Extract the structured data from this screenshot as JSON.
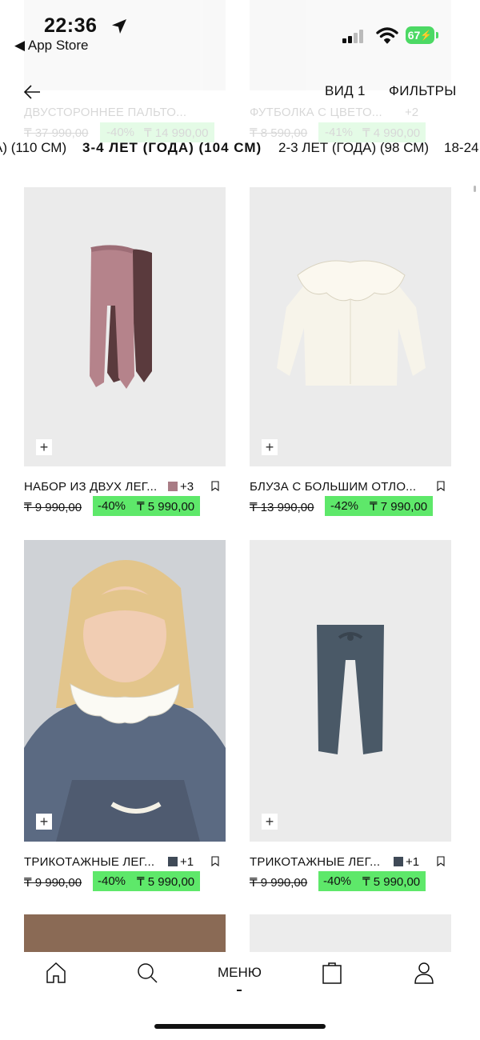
{
  "status_bar": {
    "time": "22:36",
    "back_app": "◀ App Store",
    "battery": "67"
  },
  "header": {
    "view_label": "ВИД 1",
    "filters_label": "ФИЛЬТРЫ"
  },
  "behind": [
    {
      "name": "ДВУСТОРОННЕЕ ПАЛЬТО...",
      "old_price": "₸ 37 990,00",
      "discount": "-40%",
      "price": "₸ 14 990,00"
    },
    {
      "name": "ФУТБОЛКА С ЦВЕТО...",
      "more": "+2",
      "old_price": "₸ 8 590,00",
      "discount": "-41%",
      "price": "₸ 4 990,00"
    }
  ],
  "sizes": [
    {
      "label": "А) (110 СМ)",
      "selected": false
    },
    {
      "label": "3-4 ЛЕТ (ГОДА) (104 СМ)",
      "selected": true
    },
    {
      "label": "2-3 ЛЕТ (ГОДА) (98 СМ)",
      "selected": false
    },
    {
      "label": "18-24",
      "selected": false
    }
  ],
  "products": [
    {
      "name": "НАБОР ИЗ ДВУХ ЛЕГ...",
      "swatch_color": "#a97c85",
      "more": "+3",
      "old_price": "₸ 9 990,00",
      "discount": "-40%",
      "price": "₸ 5 990,00",
      "image": "two leggings"
    },
    {
      "name": "БЛУЗА С БОЛЬШИМ ОТЛО...",
      "old_price": "₸ 13 990,00",
      "discount": "-42%",
      "price": "₸ 7 990,00",
      "image": "white blouse"
    },
    {
      "name": "ТРИКОТАЖНЫЕ ЛЕГ...",
      "swatch_color": "#3f4a57",
      "more": "+1",
      "old_price": "₸ 9 990,00",
      "discount": "-40%",
      "price": "₸ 5 990,00",
      "image": "girl in sweater"
    },
    {
      "name": "ТРИКОТАЖНЫЕ ЛЕГ...",
      "swatch_color": "#3f4a57",
      "more": "+1",
      "old_price": "₸ 9 990,00",
      "discount": "-40%",
      "price": "₸ 5 990,00",
      "image": "knit leggings"
    }
  ],
  "bottom_nav": {
    "menu_label": "МЕНЮ",
    "icons": [
      "home-icon",
      "search-icon",
      "bag-icon",
      "profile-icon"
    ]
  },
  "colors": {
    "discount_bg": "#5ee86a",
    "battery": "#4cd964"
  }
}
